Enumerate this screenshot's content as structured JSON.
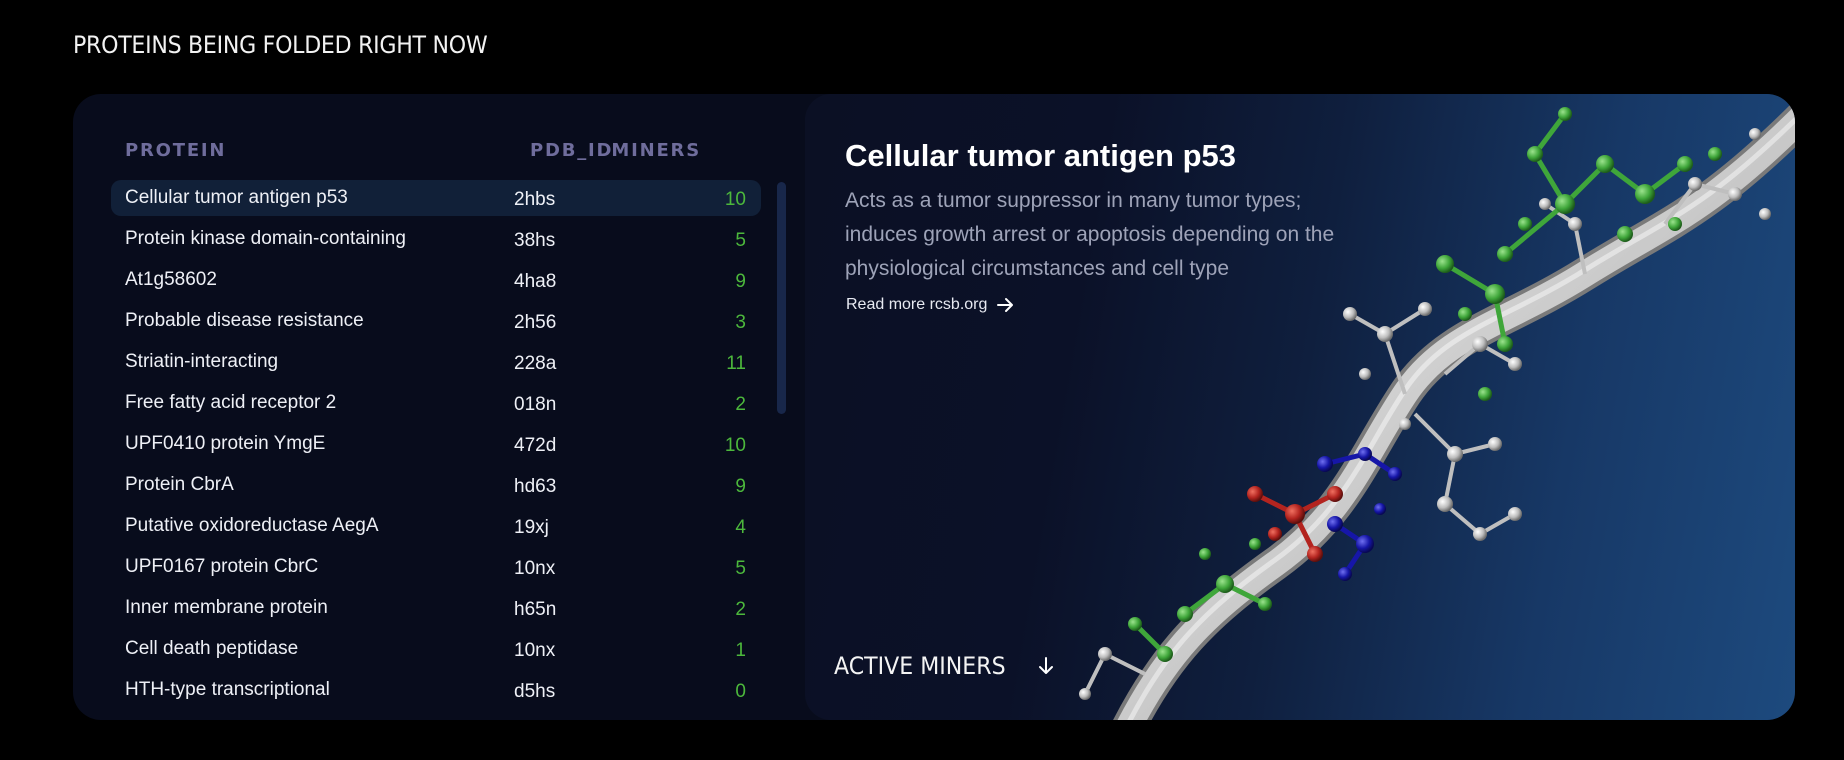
{
  "page": {
    "title": "PROTEINS BEING FOLDED RIGHT NOW"
  },
  "table": {
    "headers": {
      "protein": "PROTEIN",
      "pdb_id": "PDB_ID",
      "miners": "MINERS"
    },
    "rows": [
      {
        "name": "Cellular tumor antigen p53",
        "pdb": "2hbs",
        "miners": "10",
        "selected": true
      },
      {
        "name": "Protein kinase domain-containing",
        "pdb": "38hs",
        "miners": "5"
      },
      {
        "name": "At1g58602",
        "pdb": "4ha8",
        "miners": "9"
      },
      {
        "name": "Probable disease resistance",
        "pdb": "2h56",
        "miners": "3"
      },
      {
        "name": "Striatin-interacting",
        "pdb": "228a",
        "miners": "11"
      },
      {
        "name": "Free fatty acid receptor 2",
        "pdb": "018n",
        "miners": "2"
      },
      {
        "name": "UPF0410 protein YmgE",
        "pdb": "472d",
        "miners": "10"
      },
      {
        "name": "Protein CbrA",
        "pdb": "hd63",
        "miners": "9"
      },
      {
        "name": "Putative oxidoreductase AegA",
        "pdb": "19xj",
        "miners": "4"
      },
      {
        "name": "UPF0167 protein CbrC",
        "pdb": "10nx",
        "miners": "5"
      },
      {
        "name": "Inner membrane protein",
        "pdb": "h65n",
        "miners": "2"
      },
      {
        "name": "Cell death peptidase",
        "pdb": "10nx",
        "miners": "1"
      },
      {
        "name": "HTH-type transcriptional",
        "pdb": "d5hs",
        "miners": "0"
      }
    ]
  },
  "detail": {
    "title": "Cellular tumor antigen p53",
    "description": "Acts as a tumor suppressor in many tumor types; induces growth arrest or apoptosis depending on the physiological circumstances and cell type",
    "read_more": "Read more rcsb.org",
    "read_more_icon": "arrow-right-icon",
    "image_icon": "protein-molecule-render"
  },
  "footer": {
    "active_miners": "ACTIVE MINERS",
    "active_miners_icon": "arrow-down-icon"
  },
  "colors": {
    "background": "#000000",
    "card": "#080c1c",
    "header_text": "#6f6d9c",
    "miners_green": "#4cb83c",
    "selected_row": "#112038",
    "atom_green": "#3fa63a",
    "atom_red": "#b3241f",
    "atom_blue": "#1616a8",
    "atom_gray": "#bdbdbd"
  }
}
